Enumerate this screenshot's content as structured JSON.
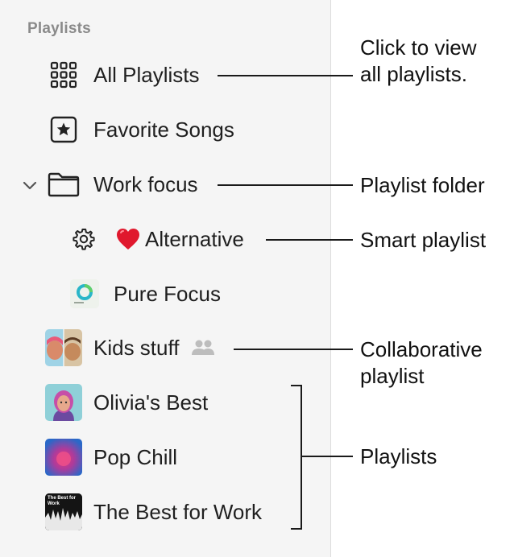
{
  "sidebar": {
    "section_title": "Playlists",
    "items": [
      {
        "label": "All Playlists",
        "icon": "grid-icon"
      },
      {
        "label": "Favorite Songs",
        "icon": "star-square-icon"
      },
      {
        "label": "Work focus",
        "icon": "folder-icon",
        "expanded": true
      },
      {
        "label": "Alternative",
        "icon": "gear-icon",
        "emoji": "❤️"
      },
      {
        "label": "Pure Focus",
        "icon": "pure-focus-artwork"
      },
      {
        "label": "Kids stuff",
        "icon": "kids-stuff-artwork",
        "collaborative": true
      },
      {
        "label": "Olivia's Best",
        "icon": "olivias-best-artwork"
      },
      {
        "label": "Pop Chill",
        "icon": "pop-chill-artwork"
      },
      {
        "label": "The Best for Work",
        "icon": "best-for-work-artwork"
      }
    ]
  },
  "callouts": {
    "all_playlists": "Click to view\nall playlists.",
    "folder": "Playlist folder",
    "smart": "Smart playlist",
    "collaborative": "Collaborative\nplaylist",
    "playlists": "Playlists"
  },
  "artwork_text": {
    "best_for_work": "The Best for Work"
  },
  "colors": {
    "sidebar_bg": "#f5f5f5",
    "section_title": "#8a8a8a",
    "heart": "#e0182d"
  }
}
